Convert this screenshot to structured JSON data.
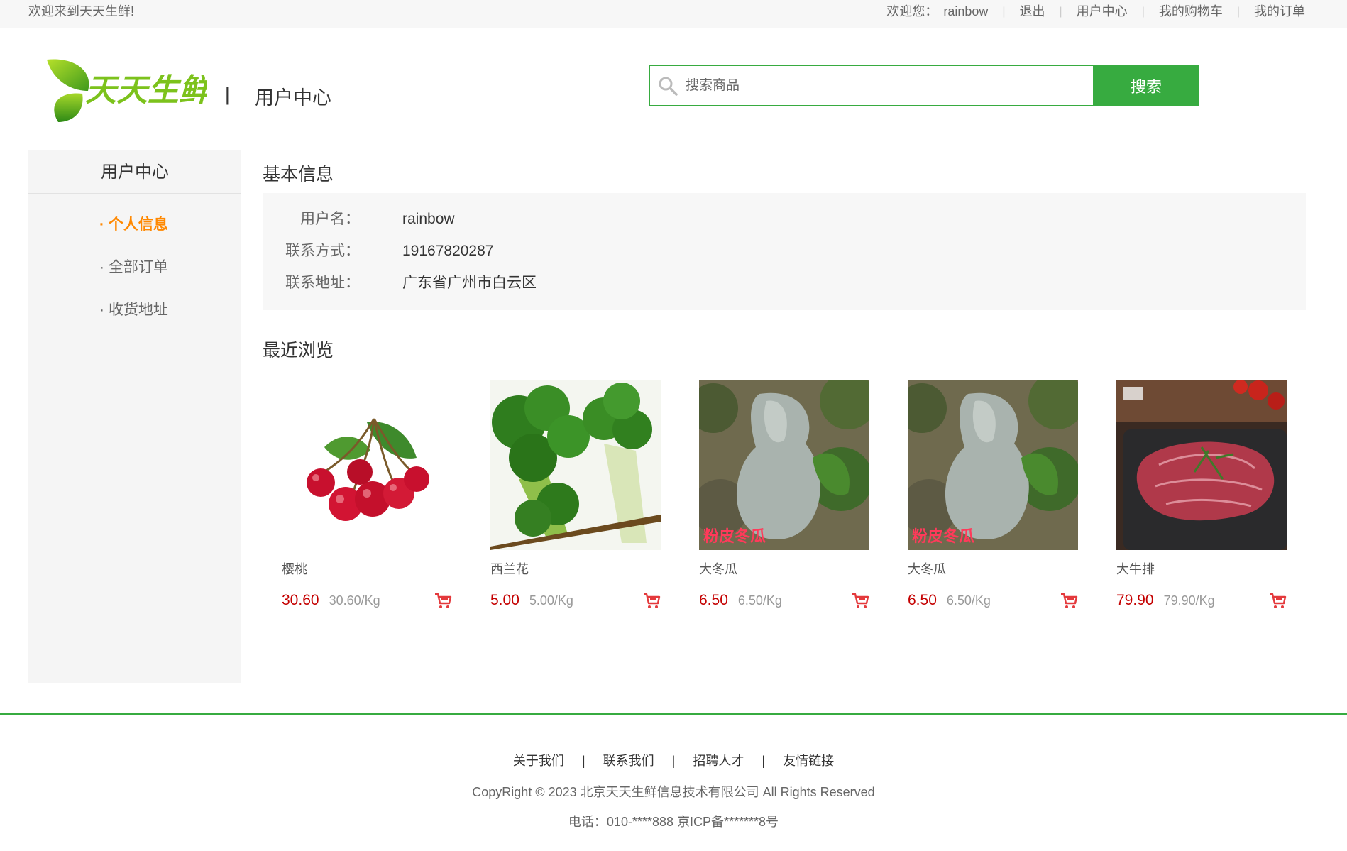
{
  "topbar": {
    "welcome": "欢迎来到天天生鲜!",
    "welcome_user_prefix": "欢迎您：",
    "username": "rainbow",
    "logout": "退出",
    "user_center": "用户中心",
    "cart": "我的购物车",
    "orders": "我的订单"
  },
  "header": {
    "logo_text": "天天生鲜",
    "separator": "|",
    "title": "用户中心",
    "search_placeholder": "搜索商品",
    "search_button": "搜索"
  },
  "sidebar": {
    "title": "用户中心",
    "items": [
      {
        "label": "· 个人信息",
        "active": true
      },
      {
        "label": "· 全部订单",
        "active": false
      },
      {
        "label": "· 收货地址",
        "active": false
      }
    ]
  },
  "basic_info": {
    "title": "基本信息",
    "rows": [
      {
        "label": "用户名：",
        "value": "rainbow"
      },
      {
        "label": "联系方式：",
        "value": "19167820287"
      },
      {
        "label": "联系地址：",
        "value": "广东省广州市白云区"
      }
    ]
  },
  "recent": {
    "title": "最近浏览",
    "items": [
      {
        "name": "樱桃",
        "price": "30.60",
        "unit": "30.60/Kg",
        "image": "cherry-image"
      },
      {
        "name": "西兰花",
        "price": "5.00",
        "unit": "5.00/Kg",
        "image": "broccoli-image"
      },
      {
        "name": "大冬瓜",
        "price": "6.50",
        "unit": "6.50/Kg",
        "image": "wax-gourd-image"
      },
      {
        "name": "大冬瓜",
        "price": "6.50",
        "unit": "6.50/Kg",
        "image": "wax-gourd-image"
      },
      {
        "name": "大牛排",
        "price": "79.90",
        "unit": "79.90/Kg",
        "image": "steak-image"
      }
    ]
  },
  "footer": {
    "links": [
      "关于我们",
      "联系我们",
      "招聘人才",
      "友情链接"
    ],
    "separator": "|",
    "copyright": "CopyRight © 2023 北京天天生鲜信息技术有限公司 All Rights Reserved",
    "tel": "电话：010-****888 京ICP备*******8号"
  },
  "colors": {
    "brand_green": "#37ab40",
    "active_orange": "#ff8800",
    "price_red": "#c40000"
  }
}
